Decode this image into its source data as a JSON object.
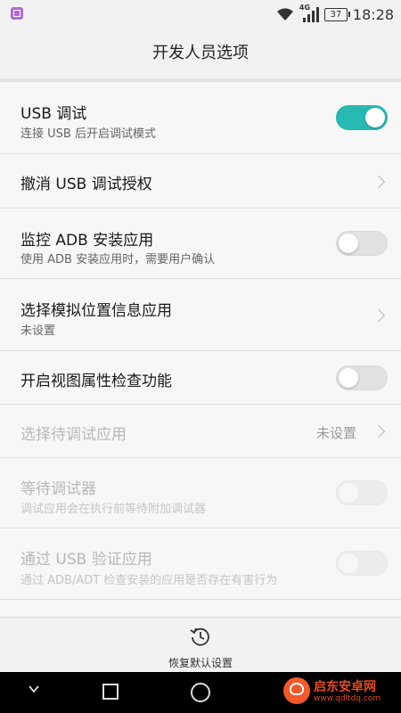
{
  "status_bar": {
    "network_type": "4G",
    "battery_level": "37",
    "time": "18:28",
    "icons": [
      "notification-app-icon",
      "wifi-icon",
      "signal-icon",
      "battery-icon"
    ]
  },
  "header": {
    "title": "开发人员选项"
  },
  "settings": {
    "usb_debugging": {
      "title": "USB 调试",
      "subtitle": "连接 USB 后开启调试模式",
      "enabled": true
    },
    "revoke_usb_auth": {
      "title": "撤消 USB 调试授权"
    },
    "monitor_adb_install": {
      "title": "监控 ADB 安装应用",
      "subtitle": "使用 ADB 安装应用时，需要用户确认",
      "enabled": false
    },
    "mock_location_app": {
      "title": "选择模拟位置信息应用",
      "subtitle": "未设置"
    },
    "view_attribute_inspection": {
      "title": "开启视图属性检查功能",
      "enabled": false
    },
    "select_debug_app": {
      "title": "选择待调试应用",
      "value": "未设置",
      "disabled": true
    },
    "wait_for_debugger": {
      "title": "等待调试器",
      "subtitle": "调试应用会在执行前等待附加调试器",
      "enabled": false,
      "disabled": true
    },
    "verify_usb_apps": {
      "title": "通过 USB 验证应用",
      "subtitle": "通过 ADB/ADT 检查安装的应用是否存在有害行为",
      "enabled": false,
      "disabled": true
    }
  },
  "bottom_bar": {
    "restore_label": "恢复默认设置"
  },
  "watermark": {
    "title": "启东安卓网",
    "url": "www.qdltdq.com"
  },
  "colors": {
    "accent": "#28b9b2",
    "background": "#f7f7f7",
    "header_bg": "#f2f2f2",
    "nav_bar": "#000000"
  }
}
